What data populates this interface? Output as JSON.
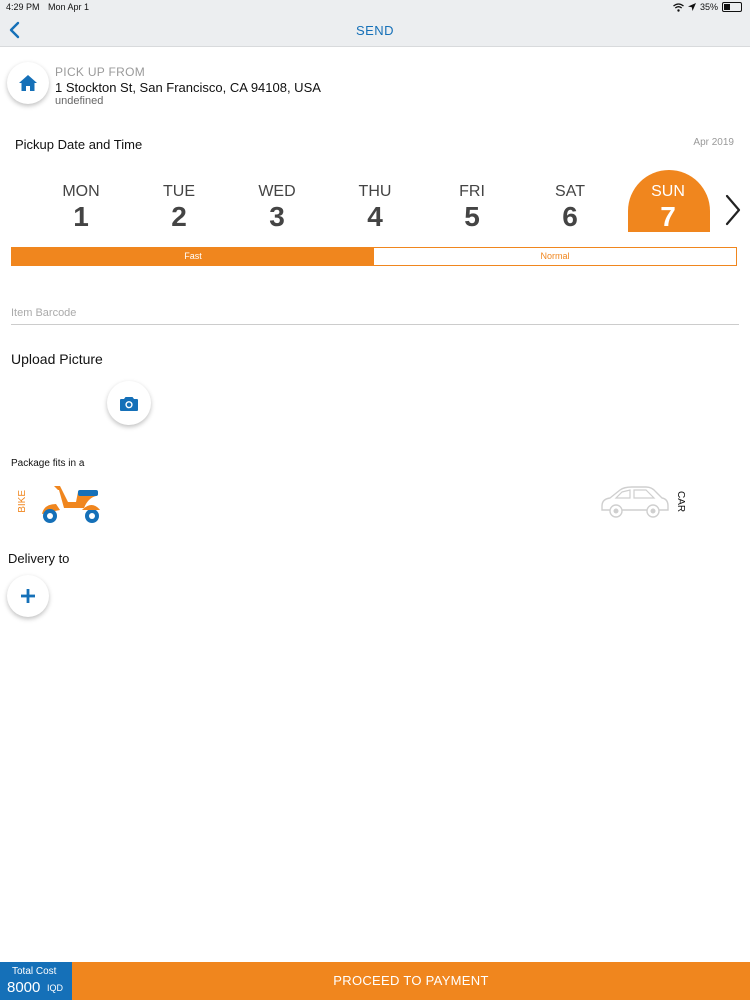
{
  "status_bar": {
    "time": "4:29 PM",
    "date": "Mon Apr 1",
    "battery": "35%",
    "icons": [
      "wifi-icon",
      "location-icon",
      "battery-icon"
    ]
  },
  "nav": {
    "title": "SEND",
    "back_icon": "chevron-left-icon"
  },
  "pickup": {
    "icon": "home-icon",
    "label": "PICK UP FROM",
    "address": "1 Stockton St, San Francisco, CA 94108, USA",
    "extra": "undefined"
  },
  "schedule": {
    "title": "Pickup Date and Time",
    "month": "Apr 2019",
    "days": [
      {
        "name": "MON",
        "num": "1"
      },
      {
        "name": "TUE",
        "num": "2"
      },
      {
        "name": "WED",
        "num": "3"
      },
      {
        "name": "THU",
        "num": "4"
      },
      {
        "name": "FRI",
        "num": "5"
      },
      {
        "name": "SAT",
        "num": "6"
      },
      {
        "name": "SUN",
        "num": "7"
      }
    ],
    "selected_day": "SUN",
    "speed_options": {
      "fast": "Fast",
      "normal": "Normal"
    },
    "selected_speed": "Fast"
  },
  "barcode": {
    "placeholder": "Item Barcode",
    "value": ""
  },
  "upload": {
    "title": "Upload Picture",
    "icon": "camera-icon"
  },
  "package": {
    "title": "Package fits in a",
    "options": {
      "bike": "BIKE",
      "car": "CAR"
    },
    "selected": "BIKE"
  },
  "delivery": {
    "title": "Delivery to",
    "icon": "plus-icon"
  },
  "footer": {
    "total_label": "Total Cost",
    "total_value": "8000",
    "currency": "IQD",
    "proceed_label": "PROCEED TO PAYMENT"
  },
  "colors": {
    "accent": "#f0861e",
    "primary": "#1570b8",
    "nav_bg": "#eceef0"
  }
}
